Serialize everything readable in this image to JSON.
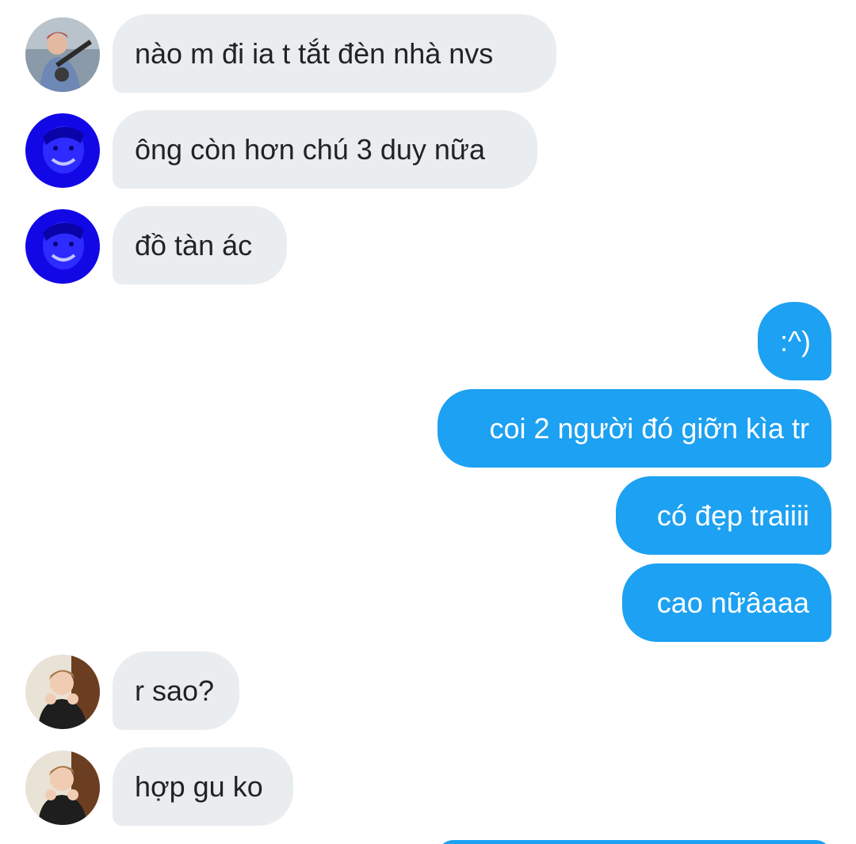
{
  "messages": [
    {
      "sender": "other",
      "avatar": "guitarist-photo",
      "text": "nào m đi ia t tắt đèn nhà nvs"
    },
    {
      "sender": "other",
      "avatar": "blue-filter-photo",
      "text": "ông còn hơn chú 3 duy nữa"
    },
    {
      "sender": "other",
      "avatar": "blue-filter-photo",
      "text": "đồ tàn ác"
    },
    {
      "sender": "me",
      "text": ":^)"
    },
    {
      "sender": "me",
      "text": "coi 2 người đó giỡn kìa tr"
    },
    {
      "sender": "me",
      "text": "có đẹp traiiii"
    },
    {
      "sender": "me",
      "text": "cao nữâaaa"
    },
    {
      "sender": "other",
      "avatar": "boy-pose-photo",
      "text": "r sao?"
    },
    {
      "sender": "other",
      "avatar": "boy-pose-photo",
      "text": "hợp gu ko"
    }
  ],
  "colors": {
    "incoming_bubble": "#e9edf0",
    "outgoing_bubble": "#1da1f2",
    "incoming_text": "#1f2326",
    "outgoing_text": "#ffffff"
  }
}
